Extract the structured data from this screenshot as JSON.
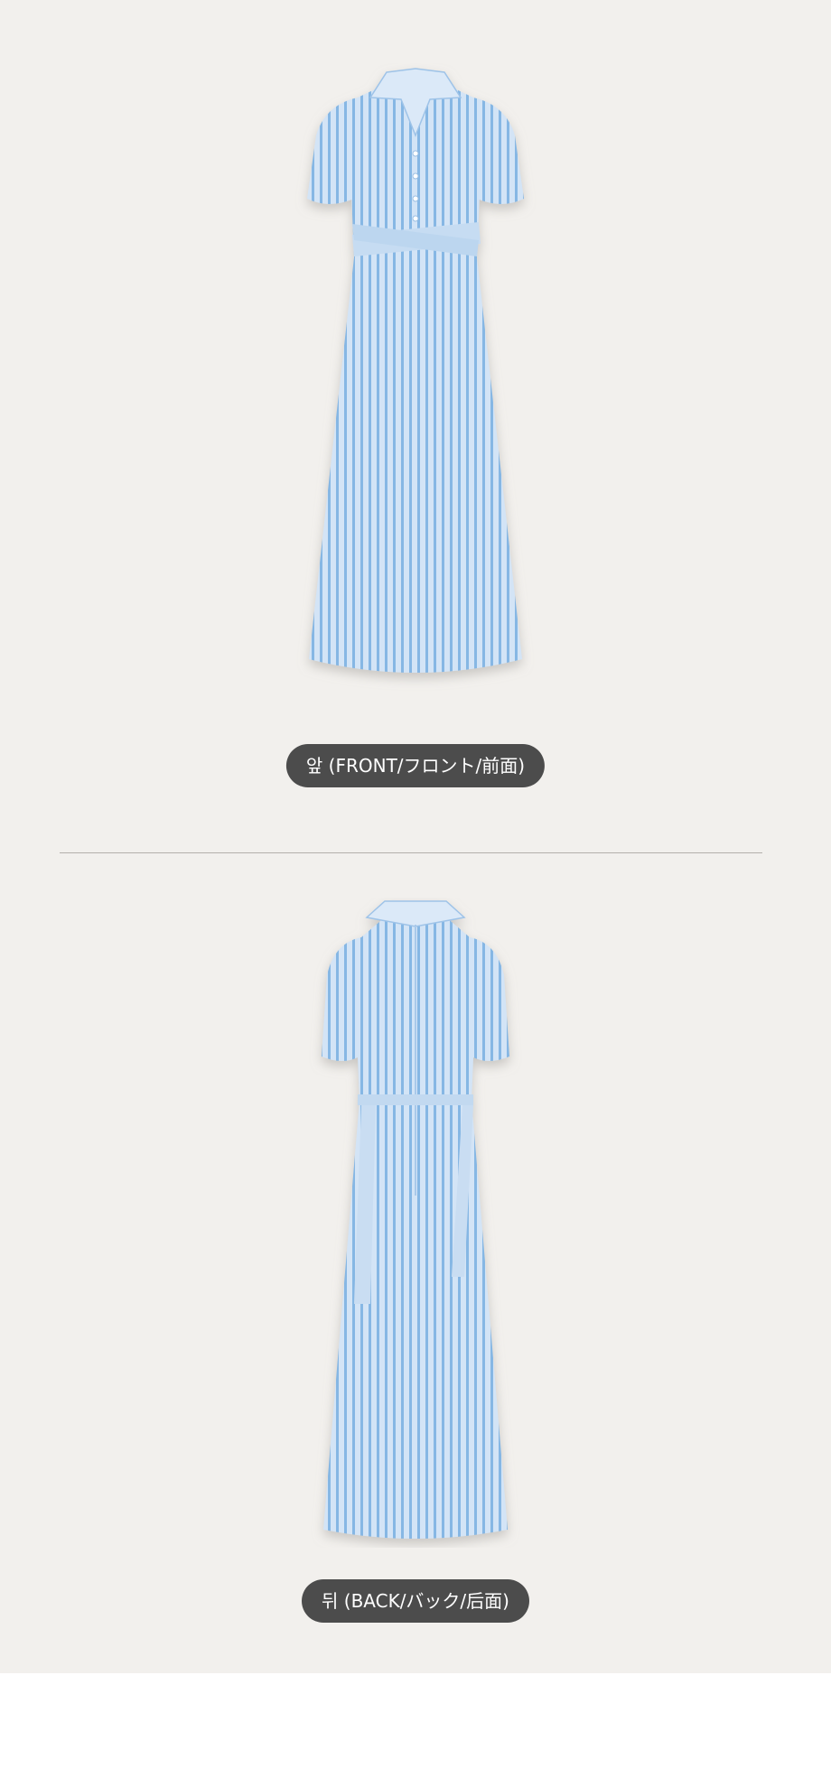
{
  "page": {
    "background": "#f2f0ed",
    "footer_background": "#ffffff"
  },
  "views": [
    {
      "label": "앞 (FRONT/フロント/前面)",
      "image": "dress-front-image"
    },
    {
      "label": "뒤 (BACK/バック/后面)",
      "image": "dress-back-image"
    }
  ],
  "garment": {
    "description_icon": "striped-shirt-dress",
    "base_color": "#cfe1f5",
    "stripe_color": "#7fb2e2",
    "shadow_color": "#c9c6c1"
  }
}
